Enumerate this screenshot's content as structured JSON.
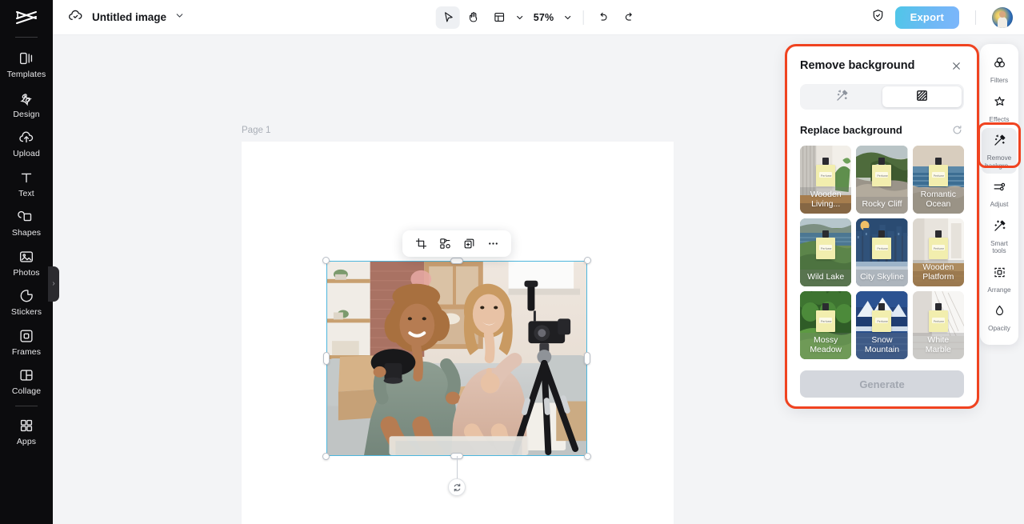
{
  "app": {
    "document_title": "Untitled image"
  },
  "toolbar": {
    "cloud_icon": "cloud-check-icon",
    "title_chevron": "chevron-down-icon",
    "select_tool": "cursor-arrow-icon",
    "hand_tool": "hand-icon",
    "layout_tool": "page-layout-icon",
    "layout_chevron": "chevron-down-icon",
    "zoom_level": "57%",
    "zoom_chevron": "chevron-down-icon",
    "undo": "undo-icon",
    "redo": "redo-icon",
    "shield_icon": "shield-check-icon",
    "export_label": "Export",
    "avatar": "user-avatar"
  },
  "left_sidebar": {
    "logo": "capcut-logo",
    "collapse_handle": "sidebar-collapse-handle",
    "items": [
      {
        "label": "Templates",
        "icon": "templates-icon"
      },
      {
        "label": "Design",
        "icon": "design-icon"
      },
      {
        "label": "Upload",
        "icon": "upload-cloud-icon"
      },
      {
        "label": "Text",
        "icon": "text-icon"
      },
      {
        "label": "Shapes",
        "icon": "shapes-icon"
      },
      {
        "label": "Photos",
        "icon": "photos-icon"
      },
      {
        "label": "Stickers",
        "icon": "stickers-icon"
      },
      {
        "label": "Frames",
        "icon": "frames-icon"
      },
      {
        "label": "Collage",
        "icon": "collage-icon"
      },
      {
        "label": "Apps",
        "icon": "apps-grid-icon"
      }
    ]
  },
  "canvas": {
    "page_label": "Page 1",
    "page_background": "#ffffff",
    "workspace_background": "#f3f4f6",
    "selection": {
      "border_color": "#4db6dd",
      "rotate_handle": "rotate-icon",
      "image_description": "Two women sitting on a sofa unboxing products in front of a camera on a tripod"
    },
    "floating_toolbar": [
      {
        "icon": "crop-icon",
        "name": "crop-button"
      },
      {
        "icon": "cutout-icon",
        "name": "cutout-button"
      },
      {
        "icon": "duplicate-icon",
        "name": "duplicate-button"
      },
      {
        "icon": "more-dots-icon",
        "name": "more-button"
      }
    ]
  },
  "remove_bg_panel": {
    "title": "Remove background",
    "close_icon": "close-icon",
    "highlight_color": "#f04320",
    "tabs": [
      {
        "name": "auto-remove-tab",
        "icon": "magic-wand-icon",
        "active": false
      },
      {
        "name": "replace-background-tab",
        "icon": "checkerboard-icon",
        "active": true
      }
    ],
    "section_title": "Replace background",
    "refresh_icon": "refresh-icon",
    "backgrounds": [
      {
        "label": "Wooden Living...",
        "name": "bg-wooden-living"
      },
      {
        "label": "Rocky Cliff",
        "name": "bg-rocky-cliff"
      },
      {
        "label": "Romantic Ocean",
        "name": "bg-romantic-ocean"
      },
      {
        "label": "Wild Lake",
        "name": "bg-wild-lake"
      },
      {
        "label": "City Skyline",
        "name": "bg-city-skyline"
      },
      {
        "label": "Wooden Platform",
        "name": "bg-wooden-platform"
      },
      {
        "label": "Mossy Meadow",
        "name": "bg-mossy-meadow"
      },
      {
        "label": "Snow Mountain",
        "name": "bg-snow-mountain"
      },
      {
        "label": "White Marble",
        "name": "bg-white-marble"
      }
    ],
    "bottle_label": "Perfume",
    "generate_label": "Generate",
    "generate_enabled": false
  },
  "right_sidebar": {
    "items": [
      {
        "label": "Filters",
        "icon": "filters-icon",
        "selected": false
      },
      {
        "label": "Effects",
        "icon": "effects-star-icon",
        "selected": false
      },
      {
        "label": "Remove backgro...",
        "icon": "magic-wand-icon",
        "selected": true
      },
      {
        "label": "Adjust",
        "icon": "sliders-icon",
        "selected": false
      },
      {
        "label": "Smart tools",
        "icon": "smart-wand-icon",
        "selected": false
      },
      {
        "label": "Arrange",
        "icon": "arrange-icon",
        "selected": false
      },
      {
        "label": "Opacity",
        "icon": "opacity-drop-icon",
        "selected": false
      }
    ]
  }
}
